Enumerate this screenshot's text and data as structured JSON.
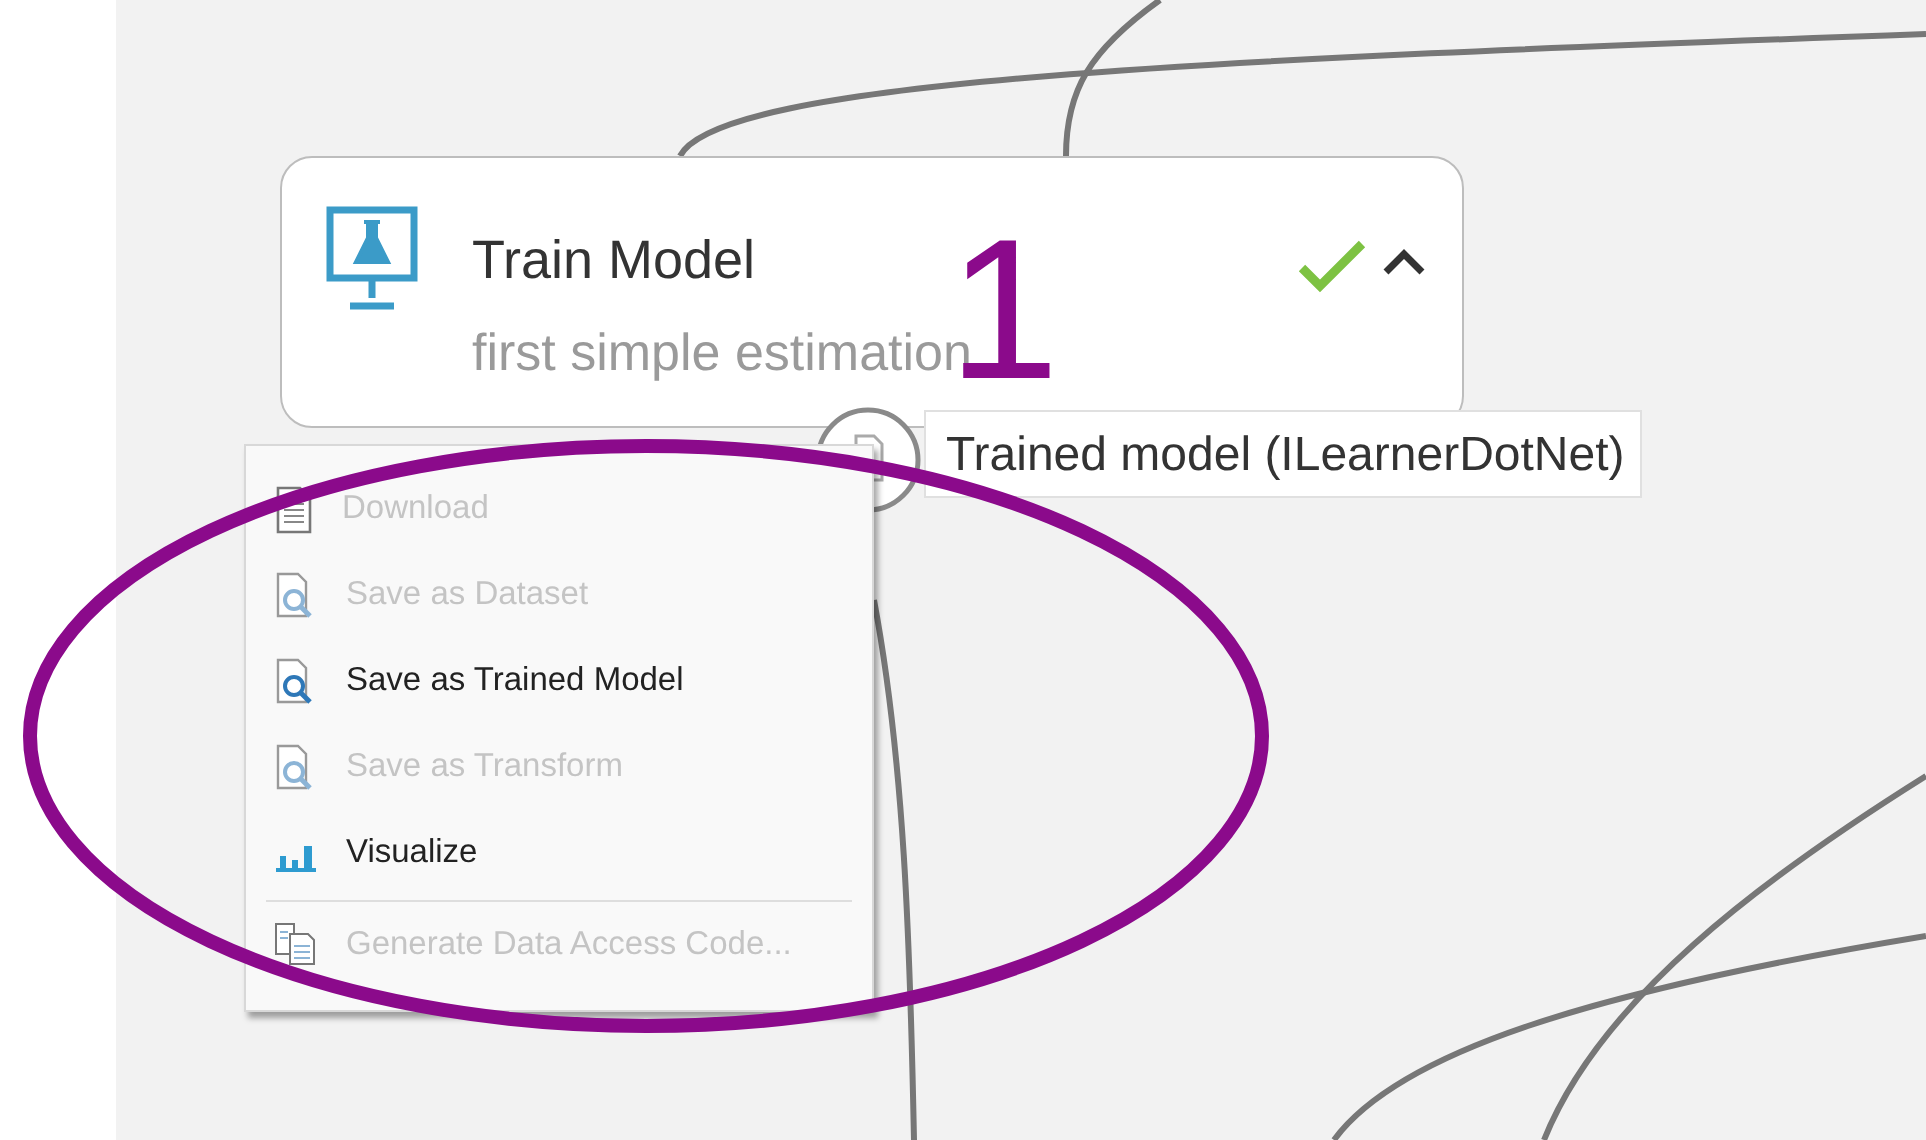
{
  "node": {
    "title": "Train Model",
    "subtitle": "first simple estimation",
    "completed": true,
    "expanded": true
  },
  "output_port": {
    "tooltip": "Trained model (ILearnerDotNet)"
  },
  "context_menu": {
    "items": [
      {
        "label": "Download",
        "kind": "document",
        "disabled": true,
        "separator_before": false
      },
      {
        "label": "Save as Dataset",
        "kind": "inspect",
        "disabled": true,
        "separator_before": false
      },
      {
        "label": "Save as Trained Model",
        "kind": "inspect",
        "disabled": false,
        "separator_before": false
      },
      {
        "label": "Save as Transform",
        "kind": "inspect",
        "disabled": true,
        "separator_before": false
      },
      {
        "label": "Visualize",
        "kind": "chart",
        "disabled": false,
        "separator_before": false
      },
      {
        "label": "Generate Data Access Code...",
        "kind": "copy",
        "disabled": true,
        "separator_before": true
      }
    ]
  },
  "annotation": {
    "label": "1"
  }
}
